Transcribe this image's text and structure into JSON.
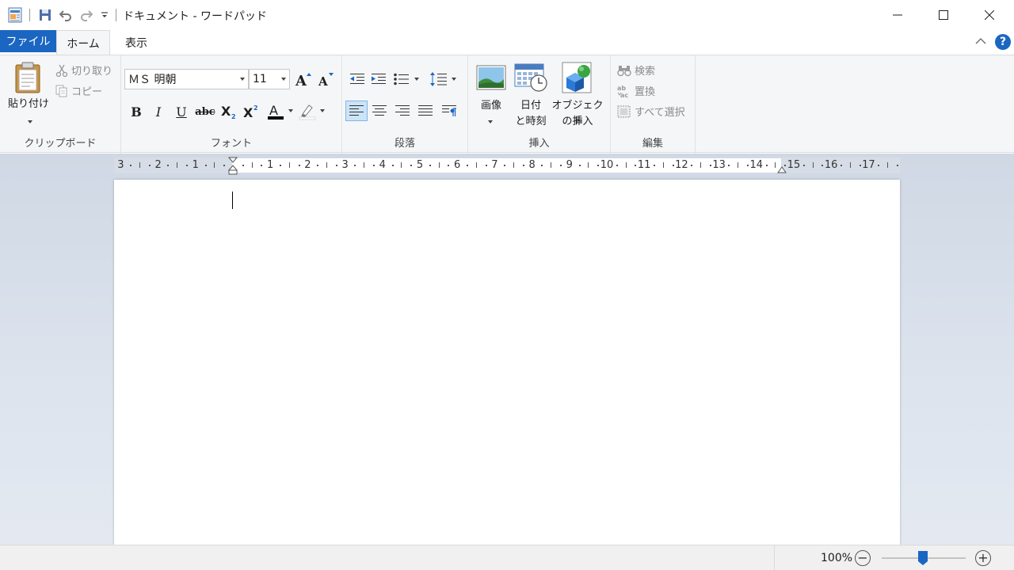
{
  "window": {
    "title": "ドキュメント - ワードパッド",
    "minimize_icon": "minimize-icon",
    "maximize_icon": "maximize-icon",
    "close_icon": "close-icon"
  },
  "tabs": {
    "file": "ファイル",
    "home": "ホーム",
    "view": "表示",
    "help": "?"
  },
  "ribbon": {
    "clipboard": {
      "label": "クリップボード",
      "paste": "貼り付け",
      "cut": "切り取り",
      "copy": "コピー"
    },
    "font": {
      "label": "フォント",
      "family": "ＭＳ 明朝",
      "size": "11",
      "bold": "B",
      "italic": "I",
      "underline": "U",
      "strike": "abc"
    },
    "paragraph": {
      "label": "段落"
    },
    "insert": {
      "label": "挿入",
      "picture": "画像",
      "datetime_1": "日付",
      "datetime_2": "と時刻",
      "object_1": "オブジェクト",
      "object_2": "の挿入"
    },
    "edit": {
      "label": "編集",
      "find": "検索",
      "replace": "置換",
      "select_all": "すべて選択"
    }
  },
  "ruler": {
    "numbers_left": [
      "3",
      "2",
      "1"
    ],
    "numbers_right": [
      "1",
      "2",
      "3",
      "4",
      "5",
      "6",
      "7",
      "8",
      "9",
      "10",
      "11",
      "12",
      "13",
      "14",
      "15",
      "16",
      "17"
    ]
  },
  "status": {
    "zoom": "100%",
    "zoom_out": "−",
    "zoom_in": "+"
  },
  "colors": {
    "accent": "#1a66c2",
    "ribbon_bg": "#f5f6f7",
    "font_color": "#000000",
    "highlight_color": "#ffffff"
  }
}
